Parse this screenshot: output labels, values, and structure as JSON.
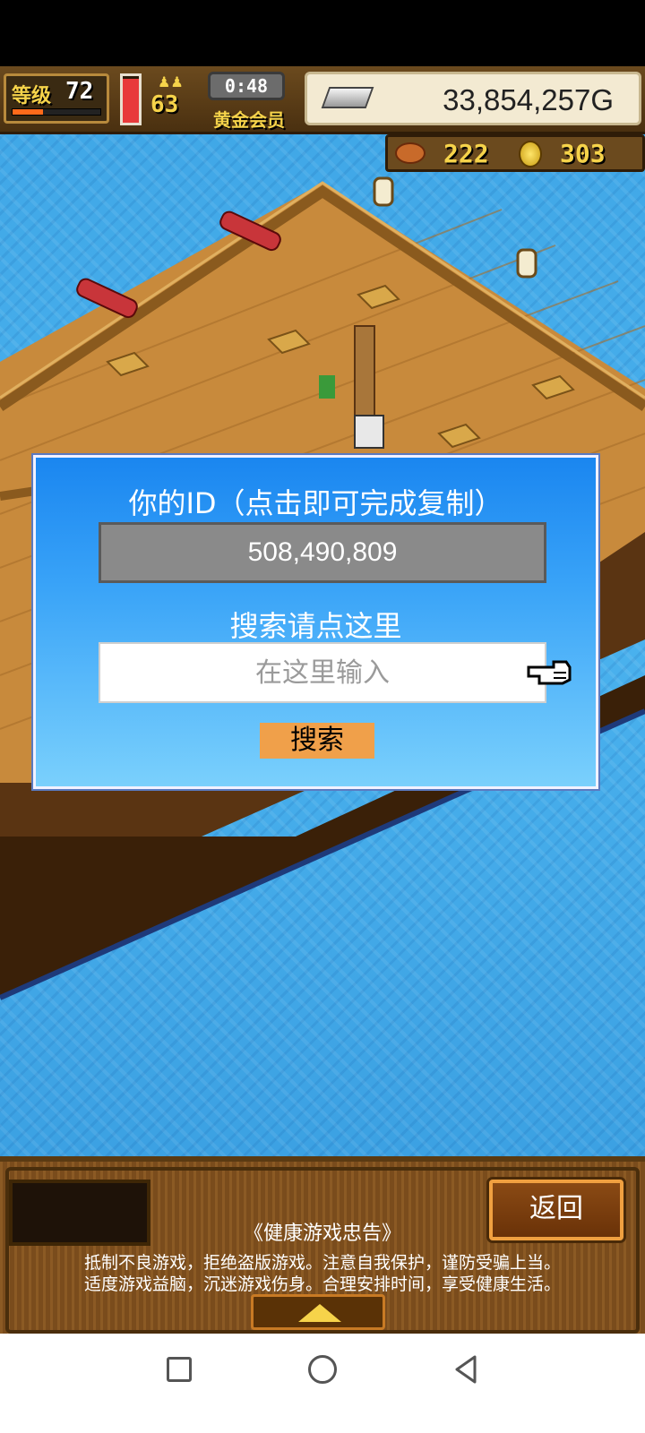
{
  "hud": {
    "level_label": "等级",
    "level_value": "72",
    "level_progress": 0.35,
    "energy_fraction": 0.95,
    "crew_count": "63",
    "timer": "0:48",
    "member_label": "黄金会员",
    "gold_value": "33,854,257G",
    "meat_value": "222",
    "coin_value": "303"
  },
  "dialog": {
    "title": "你的ID（点击即可完成复制）",
    "id_value": "508,490,809",
    "search_prompt": "搜索请点这里",
    "search_placeholder": "在这里输入",
    "search_button": "搜索"
  },
  "bottom_panel": {
    "back_button": "返回",
    "notice_title": "《健康游戏忠告》",
    "notice_line_1": "抵制不良游戏，拒绝盗版游戏。注意自我保护，谨防受骗上当。",
    "notice_line_2": "适度游戏益脑，沉迷游戏伤身。合理安排时间，享受健康生活。"
  },
  "colors": {
    "sea": "#3fa6e6",
    "deck": "#c88a3c",
    "dialog_top": "#1a86f0",
    "dialog_bottom": "#7ad0fc",
    "search_button": "#f0a04a",
    "hud_yellow": "#f6d34a"
  },
  "icons": {
    "pointer": "hand-pointer-icon",
    "silver": "silver-ingot-icon",
    "meat": "meat-icon",
    "coin": "gold-coin-icon"
  }
}
